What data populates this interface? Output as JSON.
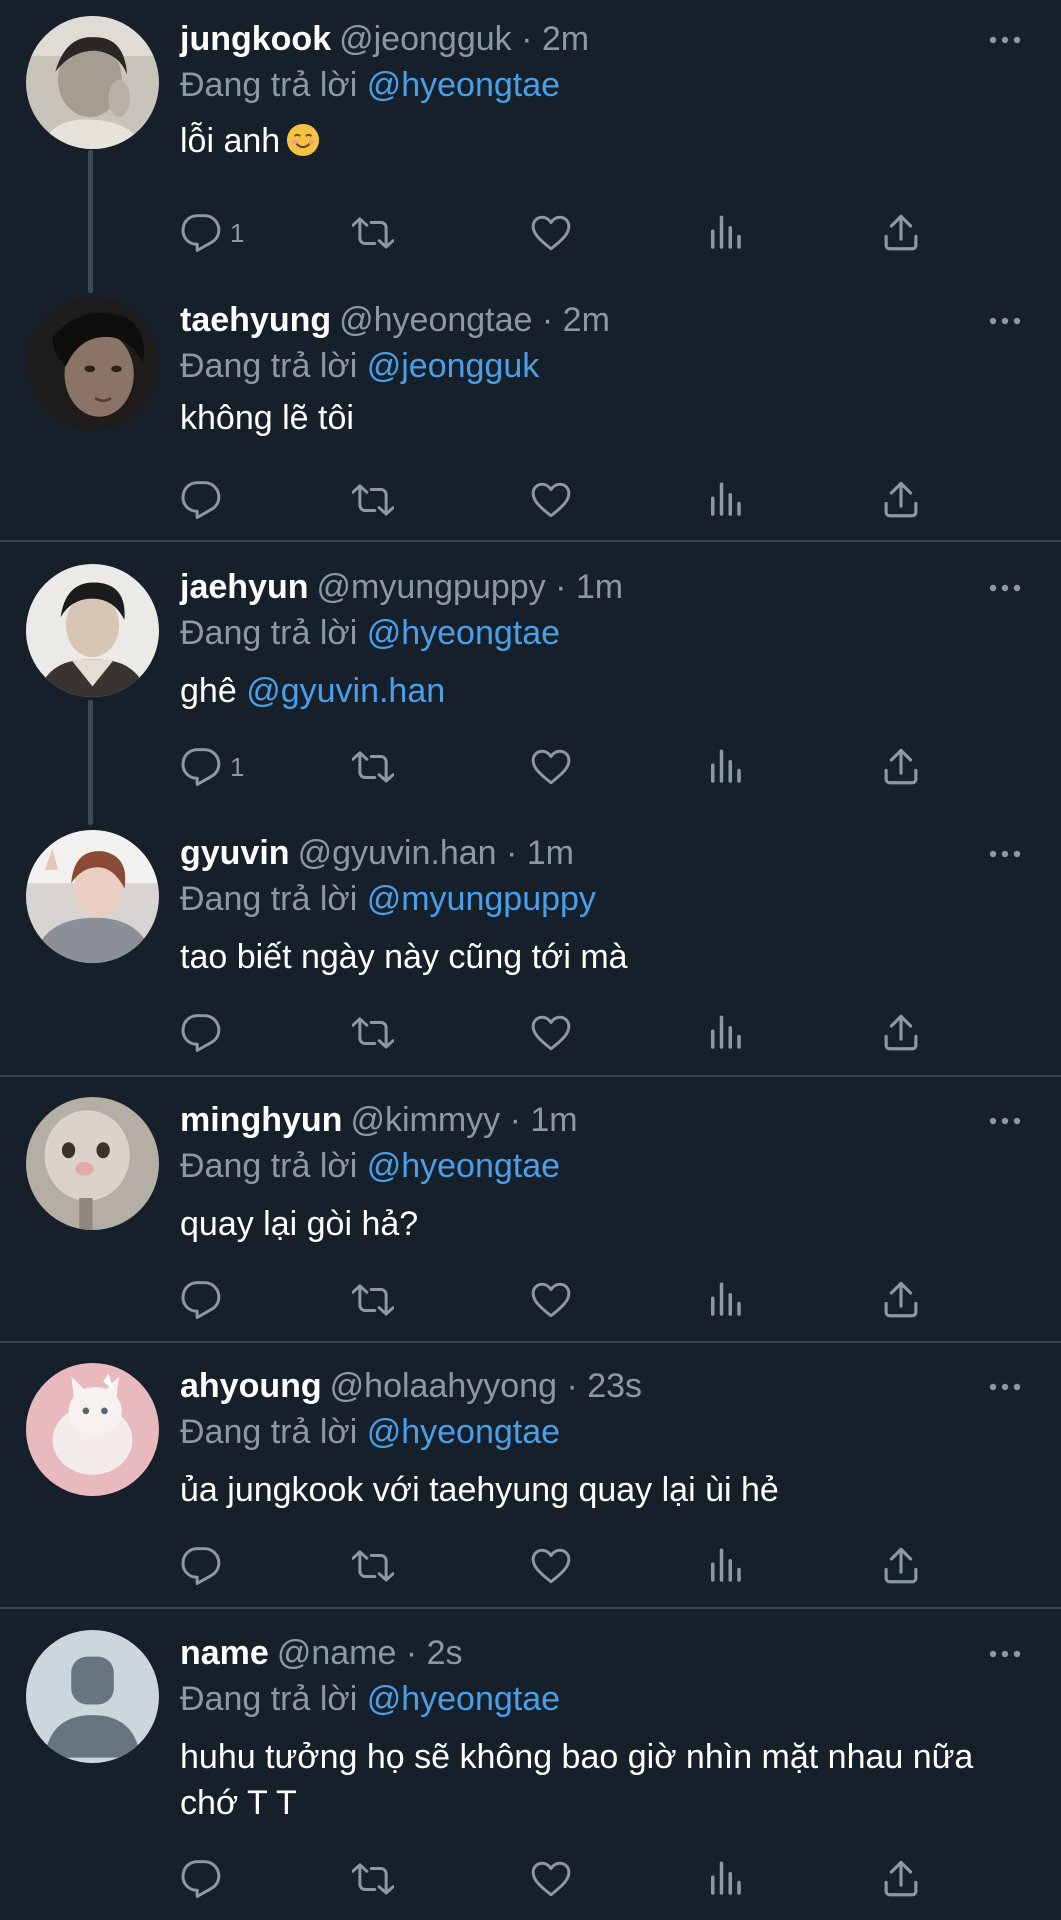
{
  "reply_prefix": "Đang trả lời",
  "colors": {
    "background": "#15202b",
    "muted_text": "#8b98a5",
    "mention": "#4a9fe8",
    "divider": "#38444d"
  },
  "icons": [
    "reply-icon",
    "retweet-icon",
    "like-icon",
    "analytics-icon",
    "share-icon",
    "more-icon",
    "smiling-face-emoji"
  ],
  "tweets": [
    {
      "name": "jungkook",
      "meta": "@jeongguk · 2m",
      "reply_to": "@hyeongtae",
      "text": "lỗi anh",
      "emoji": "☺️",
      "reply_count": "1"
    },
    {
      "name": "taehyung",
      "meta": "@hyeongtae · 2m",
      "reply_to": "@jeongguk",
      "text": "không lẽ tôi",
      "reply_count": ""
    },
    {
      "name": "jaehyun",
      "meta": "@myungpuppy · 1m",
      "reply_to": "@hyeongtae",
      "text": "ghê",
      "mention": "@gyuvin.han",
      "reply_count": "1"
    },
    {
      "name": "gyuvin",
      "meta": "@gyuvin.han · 1m",
      "reply_to": "@myungpuppy",
      "text": "tao biết ngày này cũng tới mà",
      "reply_count": ""
    },
    {
      "name": "minghyun",
      "meta": "@kimmyy · 1m",
      "reply_to": "@hyeongtae",
      "text": "quay lại gòi hả?",
      "reply_count": ""
    },
    {
      "name": "ahyoung",
      "meta": "@holaahyyong · 23s",
      "reply_to": "@hyeongtae",
      "text": "ủa jungkook với taehyung quay lại ùi hẻ",
      "reply_count": ""
    },
    {
      "name": "name",
      "meta": "@name · 2s",
      "reply_to": "@hyeongtae",
      "text": "huhu tưởng họ sẽ không bao giờ nhìn mặt nhau nữa chớ T T",
      "reply_count": ""
    }
  ]
}
